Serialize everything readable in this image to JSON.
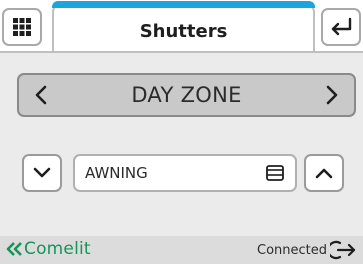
{
  "header": {
    "title": "Shutters",
    "menu_icon": "grid-menu-icon",
    "back_icon": "return-arrow-icon",
    "accent_color": "#1aa5dd"
  },
  "zone": {
    "label": "DAY ZONE",
    "prev_icon": "chevron-left-icon",
    "next_icon": "chevron-right-icon"
  },
  "device": {
    "label": "AWNING",
    "type_icon": "shutter-icon",
    "down_icon": "chevron-down-icon",
    "up_icon": "chevron-up-icon"
  },
  "footer": {
    "brand": "Comelit",
    "brand_color": "#17935c",
    "status": "Connected",
    "status_icon": "logout-icon"
  }
}
